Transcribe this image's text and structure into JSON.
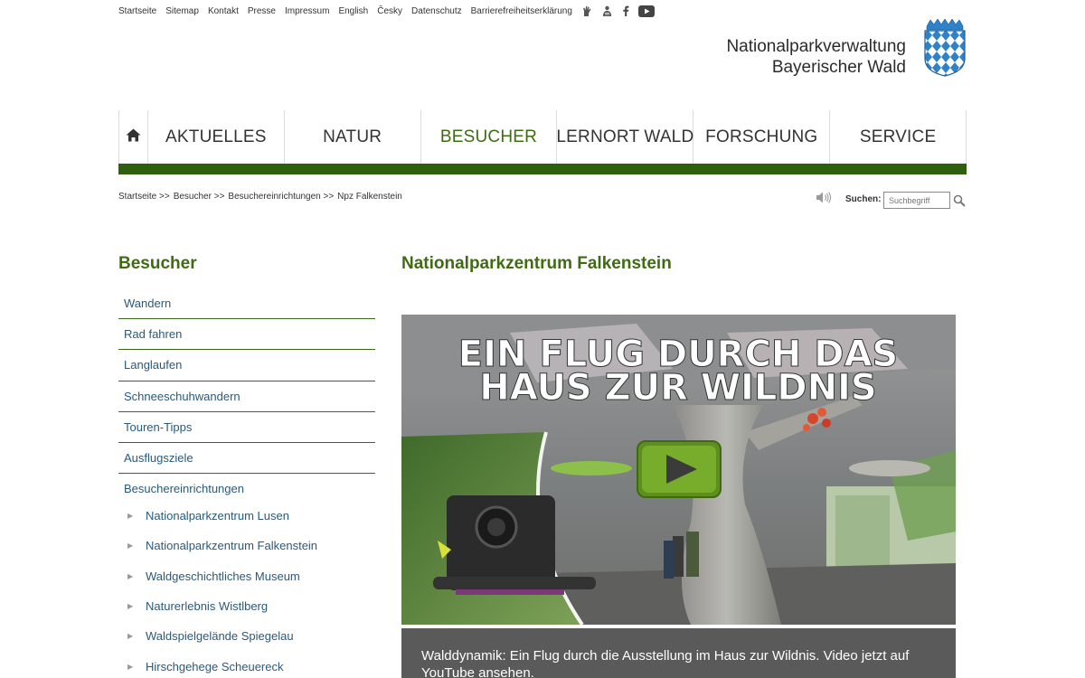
{
  "topnav": {
    "links": [
      "Startseite",
      "Sitemap",
      "Kontakt",
      "Presse",
      "Impressum",
      "English",
      "Česky",
      "Datenschutz",
      "Barrierefreiheitserklärung"
    ],
    "icons": [
      "sign-language-icon",
      "easy-language-icon",
      "facebook-icon",
      "youtube-icon"
    ]
  },
  "org": {
    "line1": "Nationalparkverwaltung",
    "line2": "Bayerischer Wald",
    "crest": "bavarian-crest-logo"
  },
  "mainnav": {
    "home_icon": "home-icon",
    "items": [
      "AKTUELLES",
      "NATUR",
      "BESUCHER",
      "LERNORT WALD",
      "FORSCHUNG",
      "SERVICE"
    ],
    "active": "BESUCHER",
    "accent_color": "#2e5f0e"
  },
  "breadcrumb": {
    "items": [
      "Startseite >>",
      "Besucher >>",
      "Besuchereinrichtungen >>",
      "Npz Falkenstein"
    ]
  },
  "search": {
    "label": "Suchen:",
    "placeholder": "Suchbegriff",
    "speaker_icon": "speaker-icon",
    "button_icon": "search-icon"
  },
  "sidebar": {
    "title": "Besucher",
    "items": [
      "Wandern",
      "Rad fahren",
      "Langlaufen",
      "Schneeschuhwandern",
      "Touren-Tipps",
      "Ausflugsziele"
    ],
    "group": {
      "label": "Besuchereinrichtungen",
      "children": [
        "Nationalparkzentrum Lusen",
        "Nationalparkzentrum Falkenstein",
        "Waldgeschichtliches Museum",
        "Naturerlebnis Wistlberg",
        "Waldspielgelände Spiegelau",
        "Hirschgehege Scheuereck"
      ]
    }
  },
  "main": {
    "title": "Nationalparkzentrum Falkenstein",
    "video": {
      "headline_line1": "EIN FLUG DURCH DAS",
      "headline_line2": "HAUS ZUR WILDNIS",
      "play_icon": "play-icon"
    },
    "caption": "Walddynamik: Ein Flug durch die Ausstellung im Haus zur Wildnis. Video jetzt auf YouTube ansehen."
  }
}
